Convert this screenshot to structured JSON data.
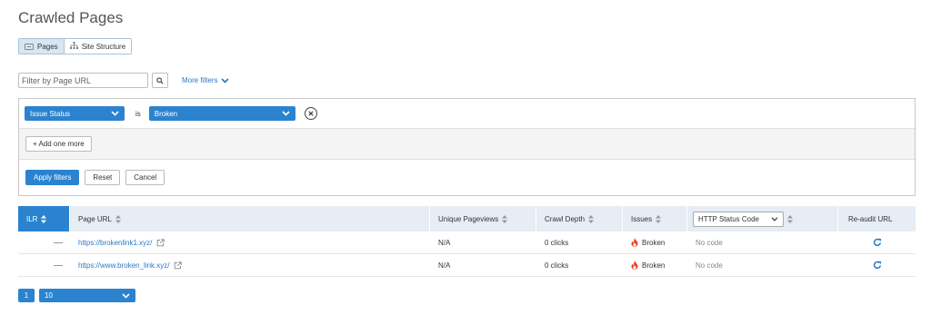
{
  "page": {
    "title": "Crawled Pages"
  },
  "view_toggle": {
    "pages_label": "Pages",
    "site_structure_label": "Site Structure"
  },
  "filter": {
    "placeholder": "Filter by Page URL",
    "more_filters_label": "More filters"
  },
  "filter_panel": {
    "field_value": "Issue Status",
    "operator_label": "is",
    "condition_value": "Broken",
    "add_one_more_label": "+ Add one more",
    "apply_label": "Apply filters",
    "reset_label": "Reset",
    "cancel_label": "Cancel"
  },
  "table": {
    "headers": {
      "ilr": "ILR",
      "page_url": "Page URL",
      "unique_pageviews": "Unique Pageviews",
      "crawl_depth": "Crawl Depth",
      "issues": "Issues",
      "http_status_code": "HTTP Status Code",
      "reaudit": "Re-audit URL"
    },
    "rows": [
      {
        "page_url": "https://brokenlink1.xyz/",
        "unique_pageviews": "N/A",
        "crawl_depth": "0 clicks",
        "issue": "Broken",
        "http_status": "No code"
      },
      {
        "page_url": "https://www.broken_link.xyz/",
        "unique_pageviews": "N/A",
        "crawl_depth": "0 clicks",
        "issue": "Broken",
        "http_status": "No code"
      }
    ]
  },
  "pagination": {
    "current_page": "1",
    "per_page": "10"
  },
  "colors": {
    "accent": "#2b83d0",
    "link": "#2b78c5",
    "header_bg": "#e6edf4",
    "flame": "#e8412c"
  }
}
